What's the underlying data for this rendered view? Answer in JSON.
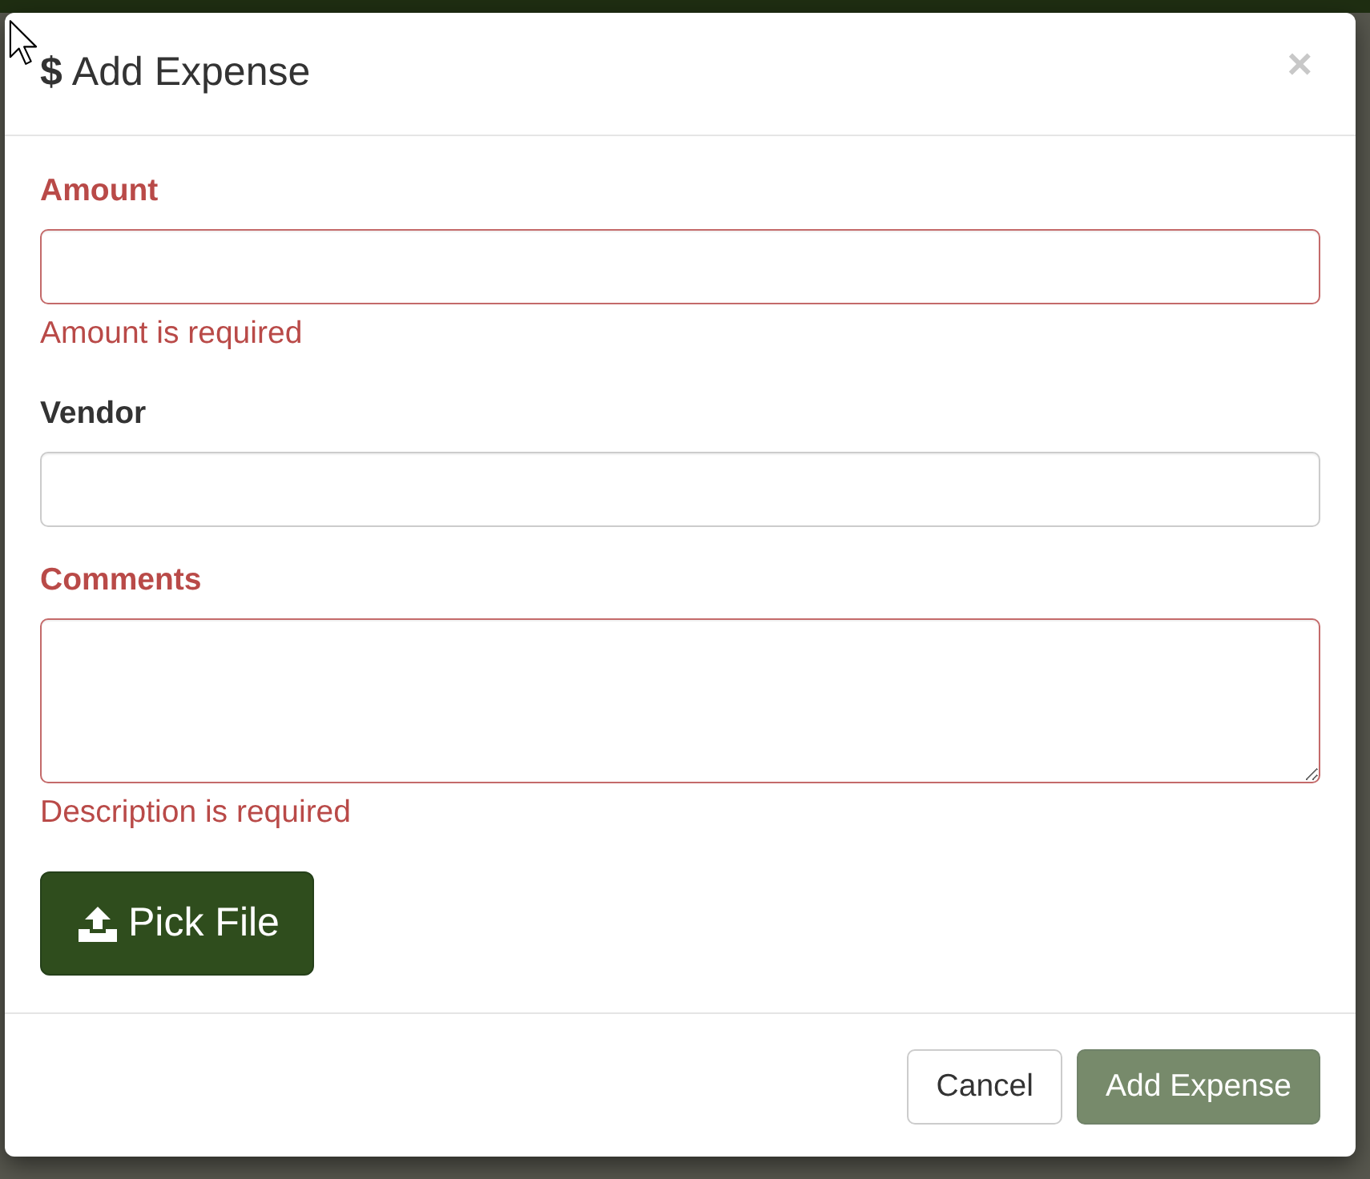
{
  "dialog": {
    "title_icon": "$",
    "title": "Add Expense",
    "close": "×"
  },
  "fields": [
    {
      "kind": "input",
      "label": "Amount",
      "invalid": true,
      "error": "Amount is required"
    },
    {
      "kind": "input",
      "label": "Vendor",
      "invalid": false
    },
    {
      "kind": "textarea",
      "label": "Comments",
      "invalid": true,
      "error": "Description is required"
    }
  ],
  "pick_file_button": {
    "label": "Pick File"
  },
  "footer_buttons": [
    {
      "kind": "default",
      "label": "Cancel",
      "disabled": false
    },
    {
      "kind": "primary",
      "label": "Add Expense",
      "disabled": true
    }
  ]
}
